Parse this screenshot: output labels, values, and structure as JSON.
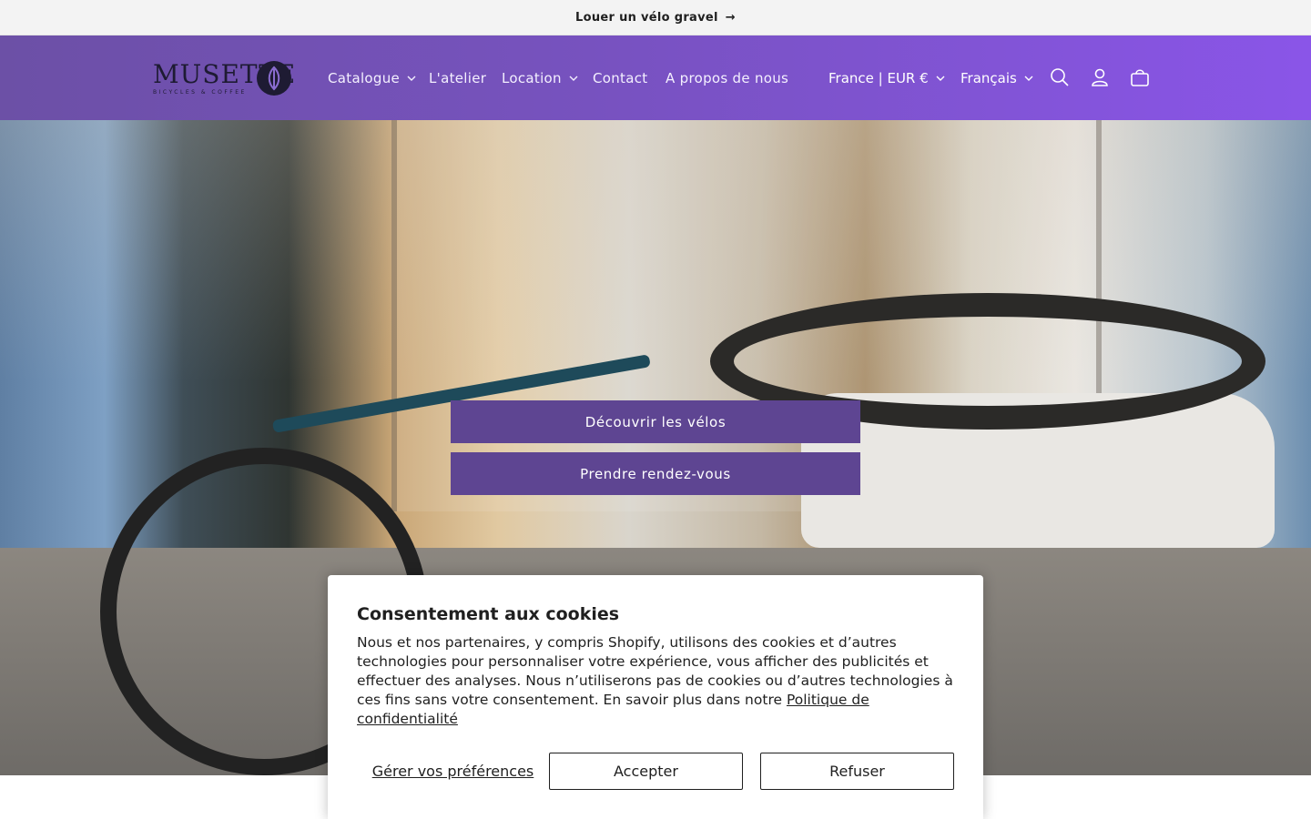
{
  "announcement": {
    "text": "Louer un vélo gravel",
    "arrow": "→"
  },
  "brand": {
    "name": "MUSETTE",
    "tagline": "BICYCLES & COFFEE"
  },
  "nav": {
    "items": [
      {
        "label": "Catalogue",
        "has_dropdown": true
      },
      {
        "label": "L'atelier",
        "has_dropdown": false
      },
      {
        "label": "Location",
        "has_dropdown": true
      },
      {
        "label": "Contact",
        "has_dropdown": false
      },
      {
        "label": "A propos de nous",
        "has_dropdown": false
      }
    ]
  },
  "utilities": {
    "country_currency": "France | EUR €",
    "language": "Français",
    "icons": [
      "search-icon",
      "account-icon",
      "cart-icon"
    ]
  },
  "hero": {
    "primary_cta": "Découvrir les vélos",
    "secondary_cta": "Prendre rendez-vous"
  },
  "cookie_banner": {
    "title": "Consentement aux cookies",
    "body": "Nous et nos partenaires, y compris Shopify, utilisons des cookies et d’autres technologies pour personnaliser votre expérience, vous afficher des publicités et effectuer des analyses. Nous n’utiliserons pas de cookies ou d’autres technologies à ces fins sans votre consentement. En savoir plus dans notre ",
    "policy_link": "Politique de confidentialité",
    "manage_label": "Gérer vos préférences",
    "accept_label": "Accepter",
    "decline_label": "Refuser"
  },
  "colors": {
    "header_gradient_start": "#6c50a6",
    "header_gradient_end": "#8a55e8",
    "cta_background": "#5e4592",
    "announcement_bg": "#f3f3f3"
  }
}
